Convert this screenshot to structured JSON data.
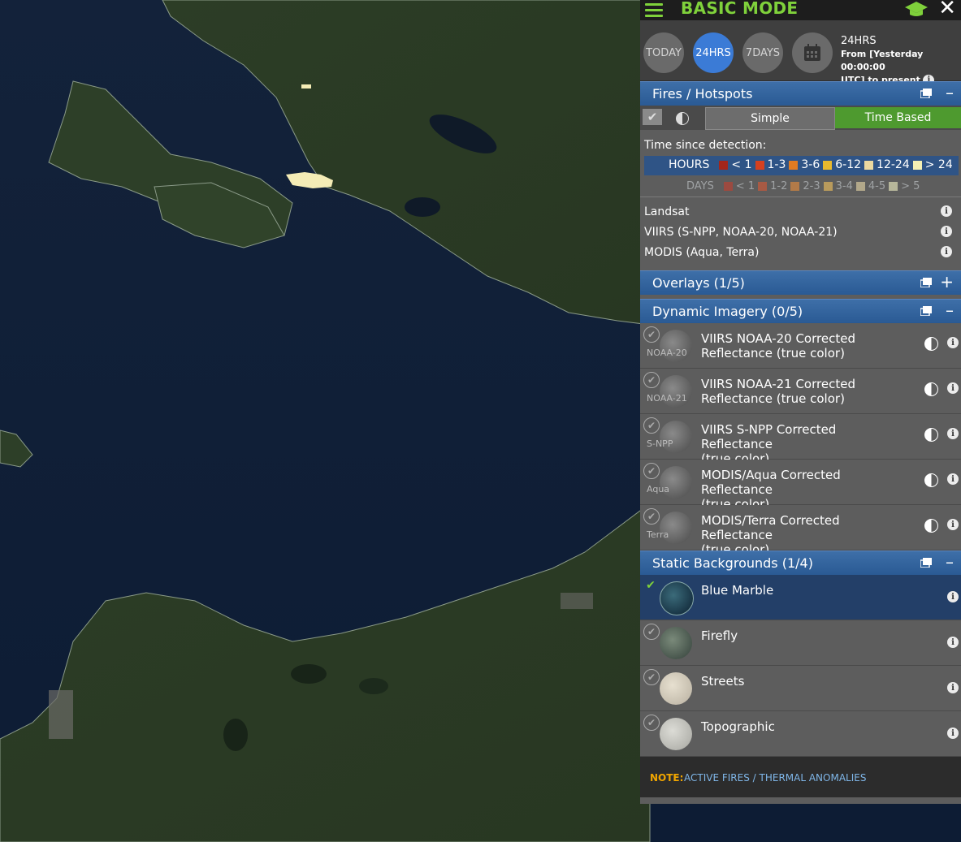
{
  "header": {
    "mode": "BASIC MODE"
  },
  "time": {
    "buttons": [
      "TODAY",
      "24HRS",
      "7DAYS"
    ],
    "active": "24HRS",
    "title": "24HRS",
    "range_line1": "From [Yesterday 00:00:00",
    "range_line2": "UTC] to present"
  },
  "fires": {
    "title": "Fires / Hotspots",
    "simple_label": "Simple",
    "time_based_label": "Time Based",
    "legend_label": "Time since detection:",
    "hours_label": "HOURS",
    "hours": [
      {
        "label": "< 1",
        "color": "#a3261b"
      },
      {
        "label": "1-3",
        "color": "#d5401f"
      },
      {
        "label": "3-6",
        "color": "#e07b22"
      },
      {
        "label": "6-12",
        "color": "#e8b92e"
      },
      {
        "label": "12-24",
        "color": "#ecd9a0"
      },
      {
        "label": "> 24",
        "color": "#f4f0b4"
      }
    ],
    "days_label": "DAYS",
    "days": [
      {
        "label": "< 1",
        "color": "#9b4a40"
      },
      {
        "label": "1-2",
        "color": "#a85a44"
      },
      {
        "label": "2-3",
        "color": "#b27a48"
      },
      {
        "label": "3-4",
        "color": "#b89a5c"
      },
      {
        "label": "4-5",
        "color": "#b2a88a"
      },
      {
        "label": "> 5",
        "color": "#b6b69a"
      }
    ],
    "sensors": [
      "Landsat",
      "VIIRS (S-NPP, NOAA-20, NOAA-21)",
      "MODIS (Aqua, Terra)"
    ]
  },
  "overlays": {
    "title": "Overlays (1/5)"
  },
  "dynamic": {
    "title": "Dynamic Imagery (0/5)",
    "layers": [
      {
        "tag": "NOAA-20",
        "line1": "VIIRS NOAA-20 Corrected",
        "line2": "Reflectance (true color)"
      },
      {
        "tag": "NOAA-21",
        "line1": "VIIRS NOAA-21 Corrected",
        "line2": "Reflectance (true color)"
      },
      {
        "tag": "S-NPP",
        "line1": "VIIRS S-NPP Corrected Reflectance",
        "line2": "(true color)"
      },
      {
        "tag": "Aqua",
        "line1": "MODIS/Aqua Corrected Reflectance",
        "line2": "(true color)"
      },
      {
        "tag": "Terra",
        "line1": "MODIS/Terra Corrected Reflectance",
        "line2": "(true color)"
      }
    ]
  },
  "static": {
    "title": "Static Backgrounds (1/4)",
    "layers": [
      "Blue Marble",
      "Firefly",
      "Streets",
      "Topographic"
    ],
    "selected": "Blue Marble"
  },
  "note": {
    "label": "NOTE:",
    "text": "ACTIVE FIRES / THERMAL ANOMALIES"
  }
}
